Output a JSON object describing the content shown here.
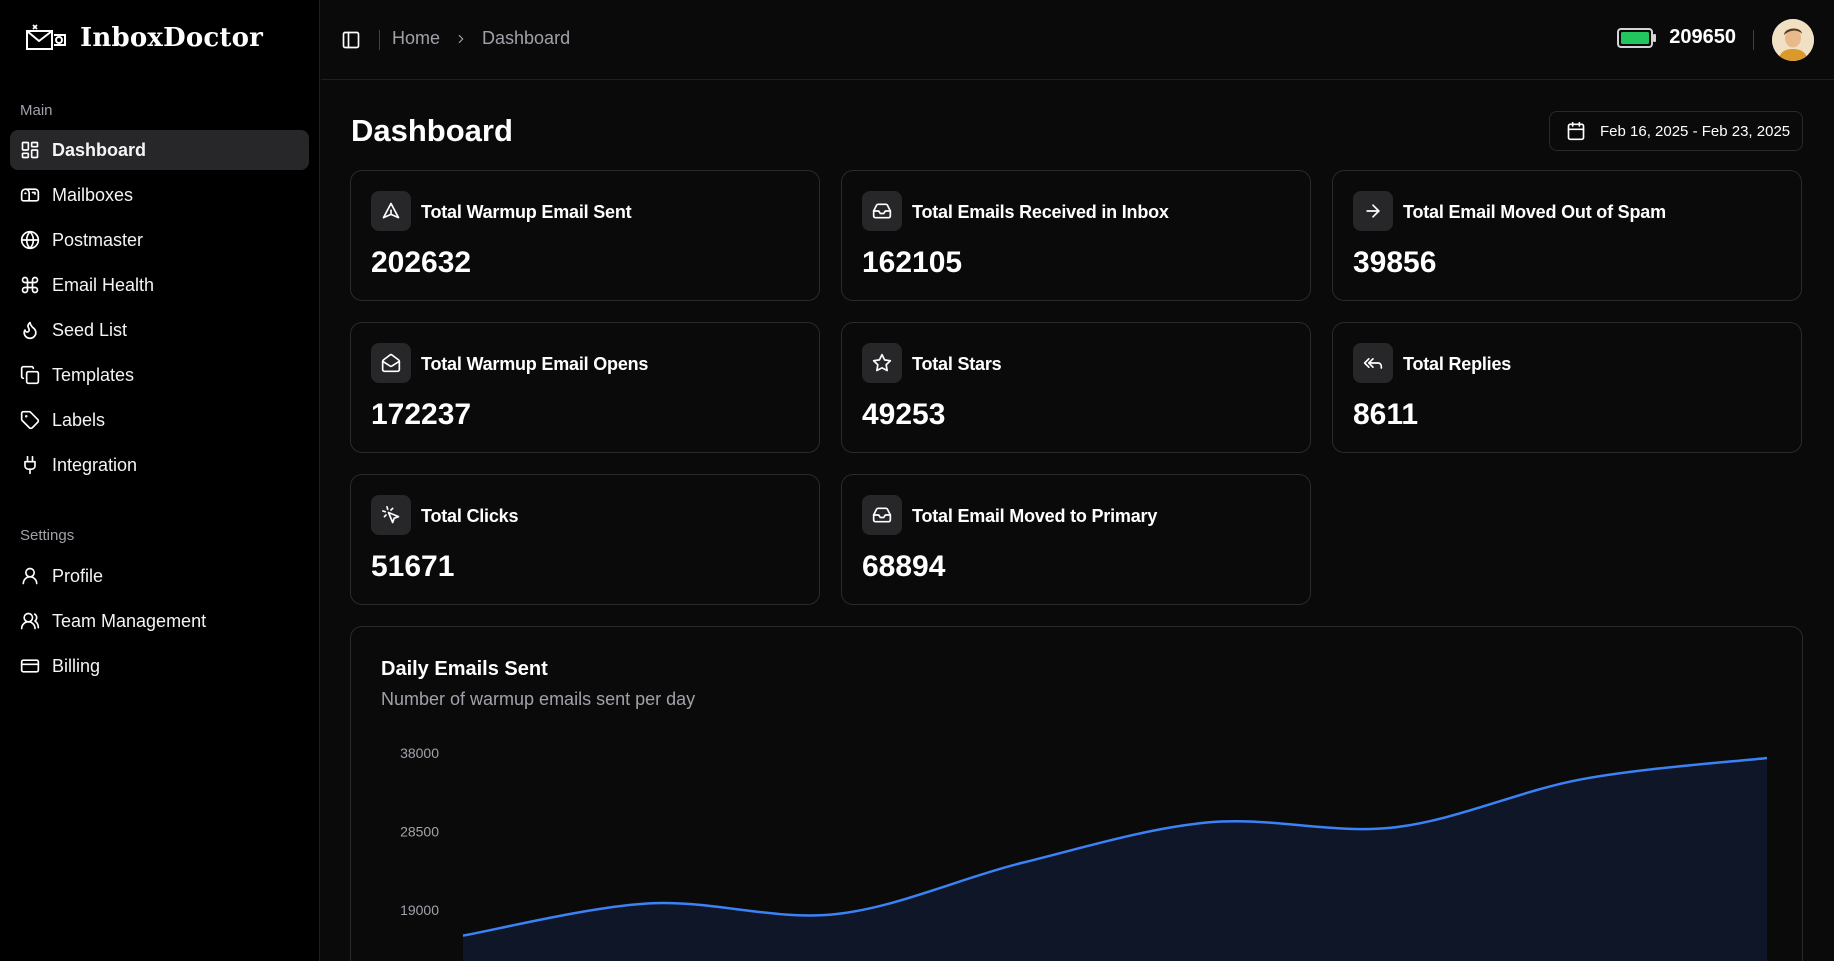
{
  "app": {
    "name": "InboxDoctor"
  },
  "sidebar": {
    "main_label": "Main",
    "main_items": [
      {
        "label": "Dashboard",
        "icon": "layout-grid-icon",
        "active": true
      },
      {
        "label": "Mailboxes",
        "icon": "mailbox-icon"
      },
      {
        "label": "Postmaster",
        "icon": "globe-icon"
      },
      {
        "label": "Email Health",
        "icon": "command-icon"
      },
      {
        "label": "Seed List",
        "icon": "flame-icon"
      },
      {
        "label": "Templates",
        "icon": "copy-icon"
      },
      {
        "label": "Labels",
        "icon": "tag-icon"
      },
      {
        "label": "Integration",
        "icon": "plug-icon"
      }
    ],
    "settings_label": "Settings",
    "settings_items": [
      {
        "label": "Profile",
        "icon": "user-icon"
      },
      {
        "label": "Team Management",
        "icon": "users-icon"
      },
      {
        "label": "Billing",
        "icon": "credit-card-icon"
      }
    ]
  },
  "header": {
    "breadcrumb": [
      "Home",
      "Dashboard"
    ],
    "credits": "209650",
    "battery_color": "#22c55e"
  },
  "main": {
    "title": "Dashboard",
    "date_range": "Feb 16, 2025 - Feb 23, 2025",
    "stats": [
      {
        "label": "Total Warmup Email Sent",
        "value": "202632",
        "icon": "send-icon"
      },
      {
        "label": "Total Emails Received in Inbox",
        "value": "162105",
        "icon": "inbox-icon"
      },
      {
        "label": "Total Email Moved Out of Spam",
        "value": "39856",
        "icon": "arrow-right-icon"
      },
      {
        "label": "Total Warmup Email Opens",
        "value": "172237",
        "icon": "mail-open-icon"
      },
      {
        "label": "Total Stars",
        "value": "49253",
        "icon": "star-icon"
      },
      {
        "label": "Total Replies",
        "value": "8611",
        "icon": "reply-all-icon"
      },
      {
        "label": "Total Clicks",
        "value": "51671",
        "icon": "mouse-pointer-click-icon"
      },
      {
        "label": "Total Email Moved to Primary",
        "value": "68894",
        "icon": "inbox-icon"
      }
    ]
  },
  "chart_data": {
    "type": "area",
    "title": "Daily Emails Sent",
    "subtitle": "Number of warmup emails sent per day",
    "y_ticks": [
      38000,
      28500,
      19000
    ],
    "x": [
      0,
      1,
      2,
      3,
      4,
      5,
      6,
      7
    ],
    "values": [
      15900,
      19800,
      18500,
      24700,
      29600,
      29000,
      34800,
      37400
    ],
    "line_color": "#3b82f6",
    "fill_color": "#0f1628",
    "grid": false
  }
}
